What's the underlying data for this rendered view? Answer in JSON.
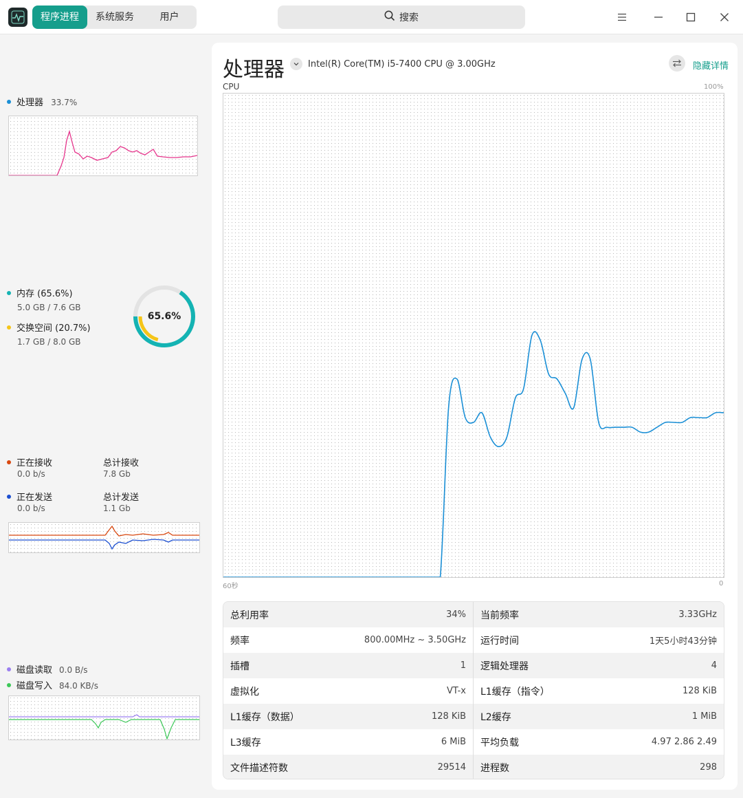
{
  "titlebar": {
    "tabs": [
      {
        "label": "程序进程",
        "active": true
      },
      {
        "label": "系统服务",
        "active": false
      },
      {
        "label": "用户",
        "active": false
      }
    ],
    "search_label": "搜索",
    "search_icon": "search-icon",
    "window_buttons": [
      "menu-icon",
      "minimize-icon",
      "maximize-icon",
      "close-icon"
    ]
  },
  "sidebar": {
    "cpu": {
      "label": "处理器",
      "value": "33.7%",
      "color": "#1a8fd6",
      "line_color": "#e6358c"
    },
    "memory": {
      "label": "内存 (65.6%)",
      "value": "5.0 GB / 7.6 GB",
      "color": "#14b3b3",
      "swap_label": "交换空间 (20.7%)",
      "swap_value": "1.7 GB / 8.0 GB",
      "swap_color": "#f5c518",
      "gauge_text": "65.6%",
      "gauge_percent": 65.6,
      "swap_percent": 20.7
    },
    "network": {
      "recv_label": "正在接收",
      "recv_value": "0.0 b/s",
      "recv_color": "#d9480f",
      "total_recv_label": "总计接收",
      "total_recv_value": "7.8 Gb",
      "send_label": "正在发送",
      "send_value": "0.0 b/s",
      "send_color": "#1c4fd0",
      "total_send_label": "总计发送",
      "total_send_value": "1.1 Gb"
    },
    "disk": {
      "read_label": "磁盘读取",
      "read_value": "0.0 B/s",
      "read_color": "#9b7ff0",
      "write_label": "磁盘写入",
      "write_value": "84.0 KB/s",
      "write_color": "#3cc858"
    }
  },
  "main": {
    "title": "处理器",
    "cpu_model": "Intel(R) Core(TM) i5-7400 CPU @ 3.00GHz",
    "hide_details": "隐藏详情",
    "chart_ylabel": "CPU",
    "chart_ymax_label": "100%",
    "chart_xstart_label": "60秒",
    "chart_xend_label": "0",
    "line_color": "#1a8fd6",
    "info": [
      [
        {
          "k": "总利用率",
          "v": "34%"
        },
        {
          "k": "当前频率",
          "v": "3.33GHz"
        }
      ],
      [
        {
          "k": "频率",
          "v": "800.00MHz ~ 3.50GHz"
        },
        {
          "k": "运行时间",
          "v": "1天5小时43分钟"
        }
      ],
      [
        {
          "k": "插槽",
          "v": "1"
        },
        {
          "k": "逻辑处理器",
          "v": "4"
        }
      ],
      [
        {
          "k": "虚拟化",
          "v": "VT-x"
        },
        {
          "k": "L1缓存（指令）",
          "v": "128 KiB"
        }
      ],
      [
        {
          "k": "L1缓存（数据）",
          "v": "128 KiB"
        },
        {
          "k": "L2缓存",
          "v": "1 MiB"
        }
      ],
      [
        {
          "k": "L3缓存",
          "v": "6 MiB"
        },
        {
          "k": "平均负载",
          "v": "4.97 2.86 2.49"
        }
      ],
      [
        {
          "k": "文件描述符数",
          "v": "29514"
        },
        {
          "k": "进程数",
          "v": "298"
        }
      ]
    ]
  },
  "chart_data": {
    "type": "line",
    "xlabel": "",
    "ylabel": "CPU",
    "xlim": [
      60,
      0
    ],
    "ylim": [
      0,
      100
    ],
    "grid": true,
    "series": [
      {
        "name": "CPU",
        "x": [
          60,
          59,
          58,
          57,
          56,
          55,
          54,
          53,
          52,
          51,
          50,
          49,
          48,
          47,
          46,
          45,
          44,
          43,
          42,
          41,
          40,
          39,
          38,
          37,
          36,
          35,
          34,
          33,
          32,
          31,
          30,
          29,
          28,
          27,
          26,
          25,
          24,
          23,
          22,
          21,
          20,
          19,
          18,
          17,
          16,
          15,
          14,
          13,
          12,
          11,
          10,
          9,
          8,
          7,
          6,
          5,
          4,
          3,
          2,
          1,
          0
        ],
        "values": [
          0,
          0,
          0,
          0,
          0,
          0,
          0,
          0,
          0,
          0,
          0,
          0,
          0,
          0,
          0,
          0,
          0,
          0,
          0,
          0,
          0,
          0,
          0,
          0,
          0,
          0,
          0,
          35,
          41,
          33,
          32,
          34,
          29,
          27,
          29,
          37,
          39,
          50,
          49,
          42,
          41,
          38,
          35,
          45,
          45,
          32,
          31,
          31,
          31,
          31,
          30,
          30,
          31,
          32,
          32,
          32,
          33,
          33,
          33,
          34,
          34
        ]
      }
    ]
  }
}
